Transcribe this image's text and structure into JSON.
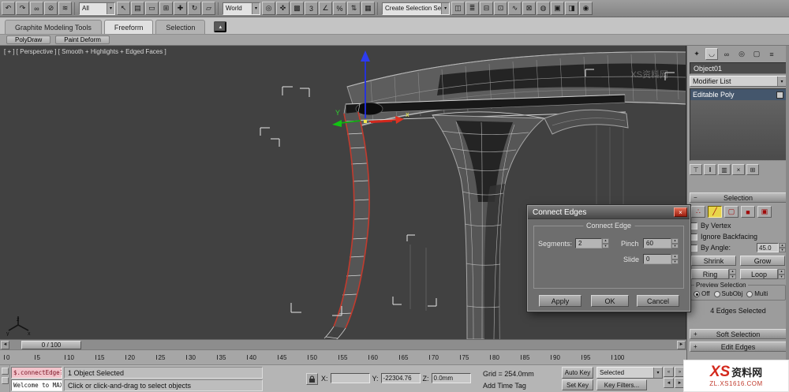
{
  "icons": {
    "chevron_down": "▾",
    "spinner_up": "▴",
    "spinner_down": "▾",
    "rollout_minus": "−",
    "rollout_plus": "+",
    "track_left": "◄",
    "track_right": "►",
    "time_prev": "«",
    "time_next": "»"
  },
  "toolbar": {
    "filter_dropdown": "All",
    "coord_dropdown": "World",
    "selset_dropdown": "Create Selection Se",
    "groups": {
      "a": [
        {
          "name": "undo-icon",
          "glyph": "↶"
        },
        {
          "name": "redo-icon",
          "glyph": "↷"
        },
        {
          "name": "select-and-link-icon",
          "glyph": "∞"
        },
        {
          "name": "unlink-selection-icon",
          "glyph": "⊘"
        },
        {
          "name": "bind-spacewarp-icon",
          "glyph": "≋"
        }
      ],
      "b": [
        {
          "name": "select-object-icon",
          "glyph": "↖"
        },
        {
          "name": "select-by-name-icon",
          "glyph": "▤"
        },
        {
          "name": "selection-region-icon",
          "glyph": "▭"
        },
        {
          "name": "window-crossing-icon",
          "glyph": "⊞"
        },
        {
          "name": "select-move-icon",
          "glyph": "✚"
        },
        {
          "name": "select-rotate-icon",
          "glyph": "↻"
        },
        {
          "name": "select-scale-icon",
          "glyph": "▱"
        }
      ],
      "c": [
        {
          "name": "pivot-center-icon",
          "glyph": "◎"
        },
        {
          "name": "select-manipulate-icon",
          "glyph": "✜"
        },
        {
          "name": "keyboard-override-icon",
          "glyph": "▩"
        },
        {
          "name": "snaps-toggle-icon",
          "glyph": "3"
        },
        {
          "name": "angle-snap-icon",
          "glyph": "∠"
        },
        {
          "name": "percent-snap-icon",
          "glyph": "%"
        },
        {
          "name": "spinner-snap-icon",
          "glyph": "⇅"
        },
        {
          "name": "edit-named-sets-icon",
          "glyph": "▦"
        }
      ],
      "d": [
        {
          "name": "mirror-icon",
          "glyph": "◫"
        },
        {
          "name": "align-icon",
          "glyph": "≣"
        },
        {
          "name": "layer-manager-icon",
          "glyph": "⊟"
        },
        {
          "name": "graphite-toggle-icon",
          "glyph": "⊡"
        },
        {
          "name": "curve-editor-icon",
          "glyph": "∿"
        },
        {
          "name": "schematic-view-icon",
          "glyph": "⊠"
        },
        {
          "name": "material-editor-icon",
          "glyph": "◍"
        },
        {
          "name": "render-setup-icon",
          "glyph": "▣"
        },
        {
          "name": "rendered-frame-icon",
          "glyph": "◨"
        },
        {
          "name": "render-production-icon",
          "glyph": "◉"
        }
      ]
    }
  },
  "ribbon": {
    "tabs": [
      {
        "label": "Graphite Modeling Tools"
      },
      {
        "label": "Freeform",
        "active": true
      },
      {
        "label": "Selection"
      }
    ],
    "collapse_icon": "▴",
    "panels": [
      {
        "label": "PolyDraw"
      },
      {
        "label": "Paint Deform"
      }
    ]
  },
  "viewport": {
    "label": "[ + ] [ Perspective ] [ Smooth + Highlights + Edged Faces ]",
    "gizmo_x": "x",
    "gizmo_y": "Y",
    "axis_x": "x",
    "axis_y": "y",
    "axis_z": "z",
    "ghost_watermark": "XS资料网"
  },
  "dialog": {
    "title": "Connect Edges",
    "close": "×",
    "group": "Connect Edge",
    "segments_label": "Segments:",
    "segments_value": "2",
    "pinch_label": "Pinch",
    "pinch_value": "60",
    "slide_label": "Slide",
    "slide_value": "0",
    "apply": "Apply",
    "ok": "OK",
    "cancel": "Cancel"
  },
  "cpanel": {
    "tabs": [
      {
        "name": "create-tab-icon",
        "glyph": "✦"
      },
      {
        "name": "modify-tab-icon",
        "glyph": "◡",
        "active": true
      },
      {
        "name": "hierarchy-tab-icon",
        "glyph": "∞"
      },
      {
        "name": "motion-tab-icon",
        "glyph": "◎"
      },
      {
        "name": "display-tab-icon",
        "glyph": "▢"
      },
      {
        "name": "utilities-tab-icon",
        "glyph": "≡"
      }
    ],
    "object_name": "Object01",
    "modifier_list": "Modifier List",
    "stack": [
      {
        "label": "Editable Poly",
        "selected": true
      }
    ],
    "stack_tools": [
      {
        "name": "pin-stack-icon",
        "glyph": "⊤"
      },
      {
        "name": "show-end-result-icon",
        "glyph": "‖"
      },
      {
        "name": "make-unique-icon",
        "glyph": "▥"
      },
      {
        "name": "remove-modifier-icon",
        "glyph": "×"
      },
      {
        "name": "configure-sets-icon",
        "glyph": "⊞"
      }
    ],
    "selection": {
      "header": "Selection",
      "subobj": [
        {
          "name": "vertex-icon",
          "glyph": "∴"
        },
        {
          "name": "edge-icon",
          "glyph": "╱",
          "active": true
        },
        {
          "name": "border-icon",
          "glyph": "▢"
        },
        {
          "name": "polygon-icon",
          "glyph": "■"
        },
        {
          "name": "element-icon",
          "glyph": "▣"
        }
      ],
      "by_vertex": "By Vertex",
      "ignore_backfacing": "Ignore Backfacing",
      "by_angle": "By Angle:",
      "by_angle_value": "45.0",
      "shrink": "Shrink",
      "grow": "Grow",
      "ring": "Ring",
      "loop": "Loop",
      "preview_label": "Preview Selection",
      "preview": [
        {
          "label": "Off",
          "selected": true
        },
        {
          "label": "SubObj"
        },
        {
          "label": "Multi"
        }
      ],
      "status": "4 Edges Selected"
    },
    "soft_selection_header": "Soft Selection",
    "edit_edges_header": "Edit Edges"
  },
  "timeline": {
    "slider": "0 / 100",
    "ticks": [
      "0",
      "5",
      "10",
      "15",
      "20",
      "25",
      "30",
      "35",
      "40",
      "45",
      "50",
      "55",
      "60",
      "65",
      "70",
      "75",
      "80",
      "85",
      "90",
      "95",
      "100"
    ]
  },
  "statusbar": {
    "listener_top": "$.connectEdge?",
    "listener_bottom": "Welcome to MAX!",
    "status_line": "1 Object Selected",
    "prompt_line": "Click or click-and-drag to select objects",
    "x_label": "X:",
    "x_value": "",
    "y_label": "Y:",
    "y_value": "-22304.76",
    "z_label": "Z:",
    "z_value": "0.0mm",
    "grid_label": "Grid = 254.0mm",
    "add_time_tag": "Add Time Tag",
    "auto_key": "Auto Key",
    "set_key": "Set Key",
    "selected_dropdown": "Selected",
    "key_filters": "Key Filters..."
  },
  "watermark": {
    "logo": "XS",
    "site": "资料网",
    "url": "ZL.XS1616.COM"
  }
}
